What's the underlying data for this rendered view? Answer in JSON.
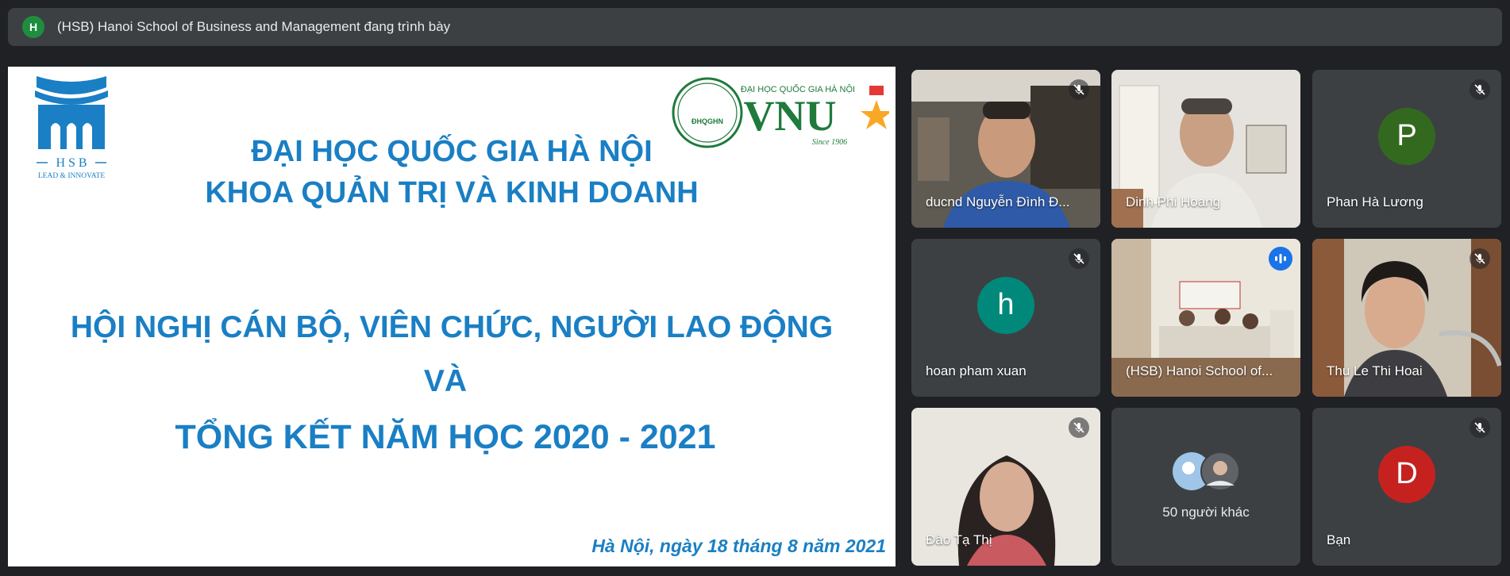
{
  "banner": {
    "avatar_letter": "H",
    "text": "(HSB) Hanoi School of Business and Management đang trình bày"
  },
  "slide": {
    "hsb_logo": {
      "letters": "H S B",
      "tagline": "LEAD & INNOVATE"
    },
    "vnu_logo": {
      "seal": "ĐHQGHN",
      "top": "ĐẠI HỌC QUỐC GIA HÀ NỘI",
      "wordmark": "VNU",
      "since": "Since 1906"
    },
    "line1": "ĐẠI HỌC QUỐC GIA HÀ NỘI",
    "line2": "KHOA QUẢN TRỊ VÀ KINH DOANH",
    "line3": "HỘI NGHỊ CÁN BỘ, VIÊN CHỨC, NGƯỜI LAO ĐỘNG",
    "line4": "VÀ",
    "line5": "TỔNG KẾT NĂM HỌC 2020 - 2021",
    "date": "Hà Nội, ngày 18 tháng 8 năm 2021"
  },
  "participants": [
    {
      "name": "ducnd Nguyễn Đình Đ...",
      "muted": true
    },
    {
      "name": "Dinh Phi Hoang",
      "muted": false
    },
    {
      "name": "Phan Hà Lương",
      "avatar_letter": "P",
      "avatar_color": "#33691e",
      "muted": true
    },
    {
      "name": "hoan pham xuan",
      "avatar_letter": "h",
      "avatar_color": "#00897b",
      "muted": true
    },
    {
      "name": "(HSB) Hanoi School of...",
      "speaking": true
    },
    {
      "name": "Thu Le Thi Hoai",
      "muted": true
    },
    {
      "name": "Đào Tạ Thị",
      "muted": true
    },
    {
      "name": "50 người khác"
    },
    {
      "name": "Bạn",
      "avatar_letter": "D",
      "avatar_color": "#c5221f",
      "muted": true
    }
  ],
  "icons": {
    "mute": "mic-off-icon",
    "speaking": "audio-level-icon"
  }
}
